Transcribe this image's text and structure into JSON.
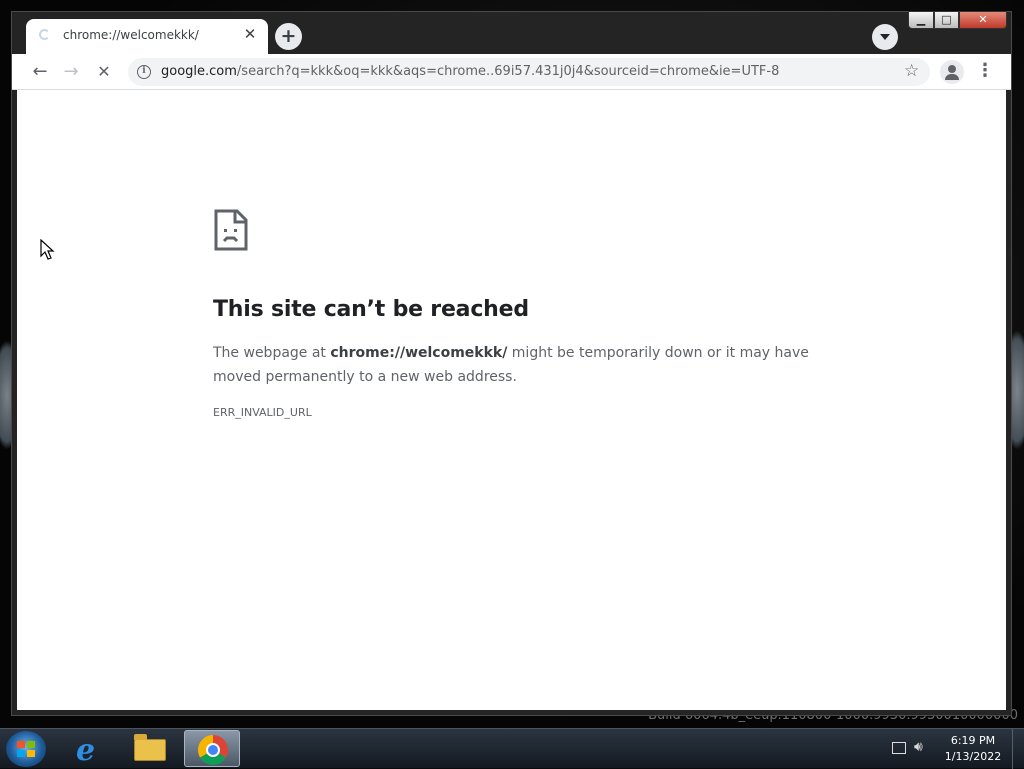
{
  "tab": {
    "title": "chrome://welcomekkk/",
    "close_glyph": "✕",
    "new_tab_glyph": "+"
  },
  "window_controls": {
    "minimize": "▁",
    "maximize": "□",
    "close": "✕"
  },
  "toolbar": {
    "back_glyph": "←",
    "forward_glyph": "→",
    "stop_glyph": "✕",
    "url_host": "google.com",
    "url_rest": "/search?q=kkk&oq=kkk&aqs=chrome..69i57.431j0j4&sourceid=chrome&ie=UTF-8",
    "info_glyph": "i",
    "bookmark_glyph": "☆",
    "menu_glyph": "⋮"
  },
  "error_page": {
    "title": "This site can’t be reached",
    "message_prefix": "The webpage at ",
    "message_url": "chrome://welcomekkk/",
    "message_suffix": " might be temporarily down or it may have moved permanently to a new web address.",
    "error_code": "ERR_INVALID_URL"
  },
  "desktop": {
    "watermark": "Build 6064.4b_eeup.110800-1000.9930.9930010000000"
  },
  "taskbar": {
    "items": [
      {
        "name": "Internet Explorer",
        "icon": "ie-icon"
      },
      {
        "name": "Windows Explorer",
        "icon": "folder-icon"
      },
      {
        "name": "Google Chrome",
        "icon": "chrome-icon",
        "active": true
      }
    ],
    "time": "6:19 PM",
    "date": "1/13/2022"
  },
  "colors": {
    "tab_strip": "#242424",
    "page_background": "#ffffff",
    "title_text": "#202124",
    "body_text": "#5f6368"
  }
}
